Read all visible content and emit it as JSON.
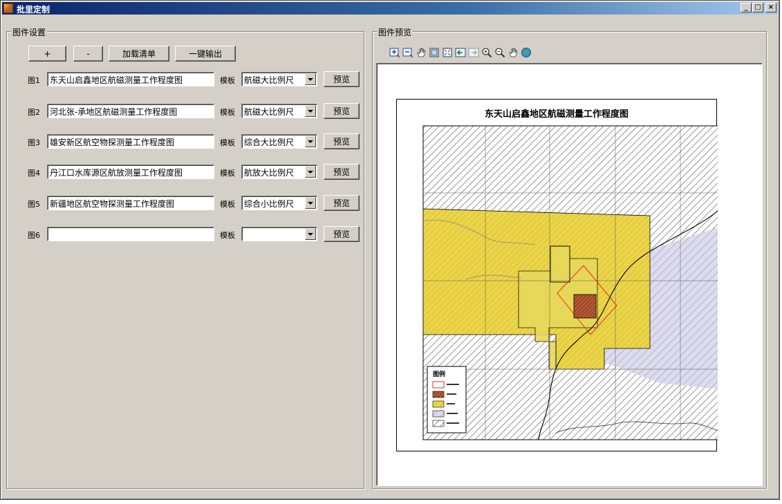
{
  "window": {
    "title": "批里定制",
    "controls": [
      "_",
      "□",
      "×"
    ]
  },
  "left_panel": {
    "legend": "图件设置",
    "buttons": {
      "add": "+",
      "remove": "-",
      "load_list": "加载清单",
      "export_all": "一键输出"
    },
    "template_label": "模板",
    "preview_label": "预览",
    "rows": [
      {
        "label": "图1",
        "name": "东天山启鑫地区航磁测量工作程度图",
        "template": "航磁大比例尺"
      },
      {
        "label": "图2",
        "name": "河北张-承地区航磁测量工作程度图",
        "template": "航磁大比例尺"
      },
      {
        "label": "图3",
        "name": "雄安新区航空物探测量工作程度图",
        "template": "综合大比例尺"
      },
      {
        "label": "图4",
        "name": "丹江口水库源区航放测量工作程度图",
        "template": "航放大比例尺"
      },
      {
        "label": "图5",
        "name": "新疆地区航空物探测量工作程度图",
        "template": "综合小比例尺"
      },
      {
        "label": "图6",
        "name": "",
        "template": ""
      }
    ]
  },
  "right_panel": {
    "legend": "图件预览",
    "toolbar_icons": [
      "zoom-in-fixed-icon",
      "zoom-out-fixed-icon",
      "pan-hand-icon",
      "full-extent-icon",
      "fit-page-icon",
      "back-extent-icon",
      "forward-extent-icon",
      "zoom-in-icon",
      "zoom-out-icon",
      "pan-icon",
      "globe-icon"
    ],
    "map": {
      "title": "东天山启鑫地区航磁测量工作程度图",
      "legend_title": "图例"
    }
  },
  "colors": {
    "face": "#d4d0c8",
    "title_start": "#0a246a",
    "title_end": "#a6caf0",
    "map_yellow": "#e8d34a",
    "map_brown": "#b5562a",
    "map_hatch_gray": "#9a9a9a",
    "map_lavender": "#d6d6ec",
    "map_red": "#e0301e"
  }
}
